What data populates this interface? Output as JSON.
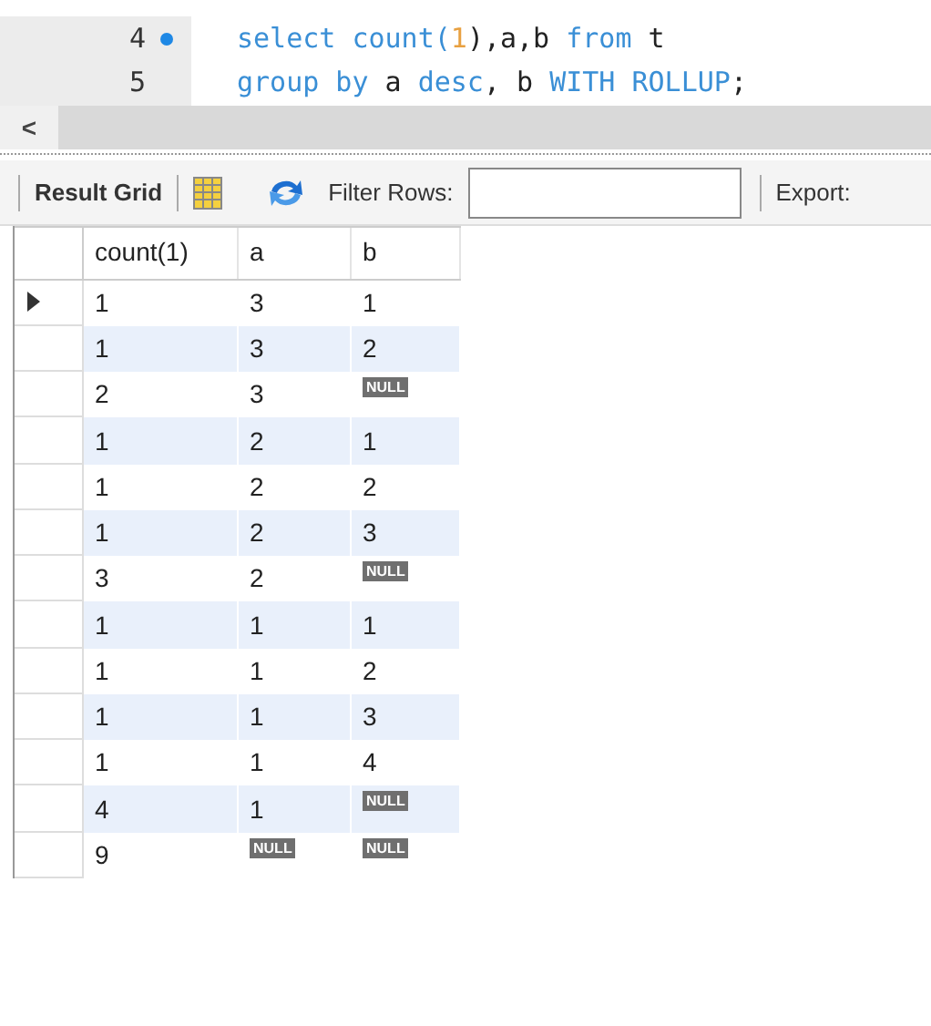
{
  "editor": {
    "lines": [
      {
        "number": "4",
        "breakpoint": true,
        "tokens": [
          {
            "kind": "keyword",
            "text": "select "
          },
          {
            "kind": "keyword",
            "text": "count("
          },
          {
            "kind": "number",
            "text": "1"
          },
          {
            "kind": "plain",
            "text": "),a,b "
          },
          {
            "kind": "keyword",
            "text": "from "
          },
          {
            "kind": "plain",
            "text": "t"
          }
        ]
      },
      {
        "number": "5",
        "breakpoint": false,
        "tokens": [
          {
            "kind": "keyword",
            "text": "group by "
          },
          {
            "kind": "plain",
            "text": "a "
          },
          {
            "kind": "keyword",
            "text": "desc"
          },
          {
            "kind": "plain",
            "text": ", b "
          },
          {
            "kind": "keyword",
            "text": "WITH ROLLUP"
          },
          {
            "kind": "plain",
            "text": ";"
          }
        ]
      }
    ],
    "scroll_left": "<"
  },
  "toolbar": {
    "result_grid": "Result Grid",
    "filter_label": "Filter Rows:",
    "export_label": "Export:"
  },
  "table": {
    "columns": [
      "count(1)",
      "a",
      "b"
    ],
    "rows": [
      {
        "selected": true,
        "cells": [
          {
            "kind": "value",
            "text": "1"
          },
          {
            "kind": "value",
            "text": "3"
          },
          {
            "kind": "value",
            "text": "1"
          }
        ]
      },
      {
        "selected": false,
        "cells": [
          {
            "kind": "value",
            "text": "1"
          },
          {
            "kind": "value",
            "text": "3"
          },
          {
            "kind": "value",
            "text": "2"
          }
        ]
      },
      {
        "selected": false,
        "cells": [
          {
            "kind": "value",
            "text": "2"
          },
          {
            "kind": "value",
            "text": "3"
          },
          {
            "kind": "null",
            "text": "NULL"
          }
        ]
      },
      {
        "selected": false,
        "cells": [
          {
            "kind": "value",
            "text": "1"
          },
          {
            "kind": "value",
            "text": "2"
          },
          {
            "kind": "value",
            "text": "1"
          }
        ]
      },
      {
        "selected": false,
        "cells": [
          {
            "kind": "value",
            "text": "1"
          },
          {
            "kind": "value",
            "text": "2"
          },
          {
            "kind": "value",
            "text": "2"
          }
        ]
      },
      {
        "selected": false,
        "cells": [
          {
            "kind": "value",
            "text": "1"
          },
          {
            "kind": "value",
            "text": "2"
          },
          {
            "kind": "value",
            "text": "3"
          }
        ]
      },
      {
        "selected": false,
        "cells": [
          {
            "kind": "value",
            "text": "3"
          },
          {
            "kind": "value",
            "text": "2"
          },
          {
            "kind": "null",
            "text": "NULL"
          }
        ]
      },
      {
        "selected": false,
        "cells": [
          {
            "kind": "value",
            "text": "1"
          },
          {
            "kind": "value",
            "text": "1"
          },
          {
            "kind": "value",
            "text": "1"
          }
        ]
      },
      {
        "selected": false,
        "cells": [
          {
            "kind": "value",
            "text": "1"
          },
          {
            "kind": "value",
            "text": "1"
          },
          {
            "kind": "value",
            "text": "2"
          }
        ]
      },
      {
        "selected": false,
        "cells": [
          {
            "kind": "value",
            "text": "1"
          },
          {
            "kind": "value",
            "text": "1"
          },
          {
            "kind": "value",
            "text": "3"
          }
        ]
      },
      {
        "selected": false,
        "cells": [
          {
            "kind": "value",
            "text": "1"
          },
          {
            "kind": "value",
            "text": "1"
          },
          {
            "kind": "value",
            "text": "4"
          }
        ]
      },
      {
        "selected": false,
        "cells": [
          {
            "kind": "value",
            "text": "4"
          },
          {
            "kind": "value",
            "text": "1"
          },
          {
            "kind": "null",
            "text": "NULL"
          }
        ]
      },
      {
        "selected": false,
        "cells": [
          {
            "kind": "value",
            "text": "9"
          },
          {
            "kind": "null",
            "text": "NULL"
          },
          {
            "kind": "null",
            "text": "NULL"
          }
        ]
      }
    ]
  }
}
